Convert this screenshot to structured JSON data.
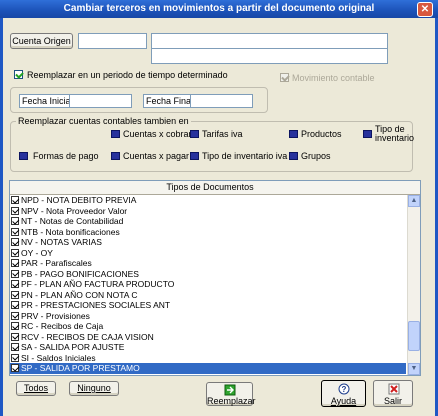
{
  "window": {
    "title": "Cambiar terceros en movimientos a partir del documento original",
    "close_glyph": "✕"
  },
  "cuenta_origen": {
    "button_label": "Cuenta Origen",
    "code_value": "",
    "name_value": ""
  },
  "periodo": {
    "label": "Reemplazar en un periodo de tiempo determinado",
    "checked": true
  },
  "movimiento_contable": {
    "label": "Movimiento contable",
    "checked": true,
    "disabled": true
  },
  "fecha": {
    "inicial_label": "Fecha Inicial",
    "inicial_value": "",
    "final_label": "Fecha Final",
    "final_value": ""
  },
  "cuentas": {
    "group_label": "Reemplazar cuentas contables tambien en",
    "items": [
      {
        "label": "Cuentas x cobrar"
      },
      {
        "label": "Tarifas iva"
      },
      {
        "label": "Productos"
      },
      {
        "label": "Tipo de inventario"
      },
      {
        "label": "Formas de pago"
      },
      {
        "label": "Cuentas x pagar"
      },
      {
        "label": "Tipo de inventario iva"
      },
      {
        "label": "Grupos"
      }
    ]
  },
  "tipos": {
    "header": "Tipos de Documentos",
    "rows": [
      "NPD - NOTA DEBITO PREVIA",
      "NPV - Nota Proveedor Valor",
      "NT - Notas de Contabilidad",
      "NTB - Nota bonificaciones",
      "NV - NOTAS VARIAS",
      "OY - OY",
      "PAR - Parafiscales",
      "PB - PAGO BONIFICACIONES",
      "PF - PLAN AÑO FACTURA PRODUCTO",
      "PN - PLAN AÑO CON NOTA C",
      "PR - PRESTACIONES SOCIALES ANT",
      "PRV - Provisiones",
      "RC - Recibos de Caja",
      "RCV - RECIBOS DE CAJA VISION",
      "SA - SALIDA POR AJUSTE",
      "SI - Saldos Iniciales",
      "SP - SALIDA POR PRESTAMO"
    ],
    "selected_index": 16
  },
  "buttons": {
    "todos": "Todos",
    "ninguno": "Ninguno",
    "reemplazar": "Reemplazar",
    "ayuda": "Ayuda",
    "salir": "Salir"
  }
}
